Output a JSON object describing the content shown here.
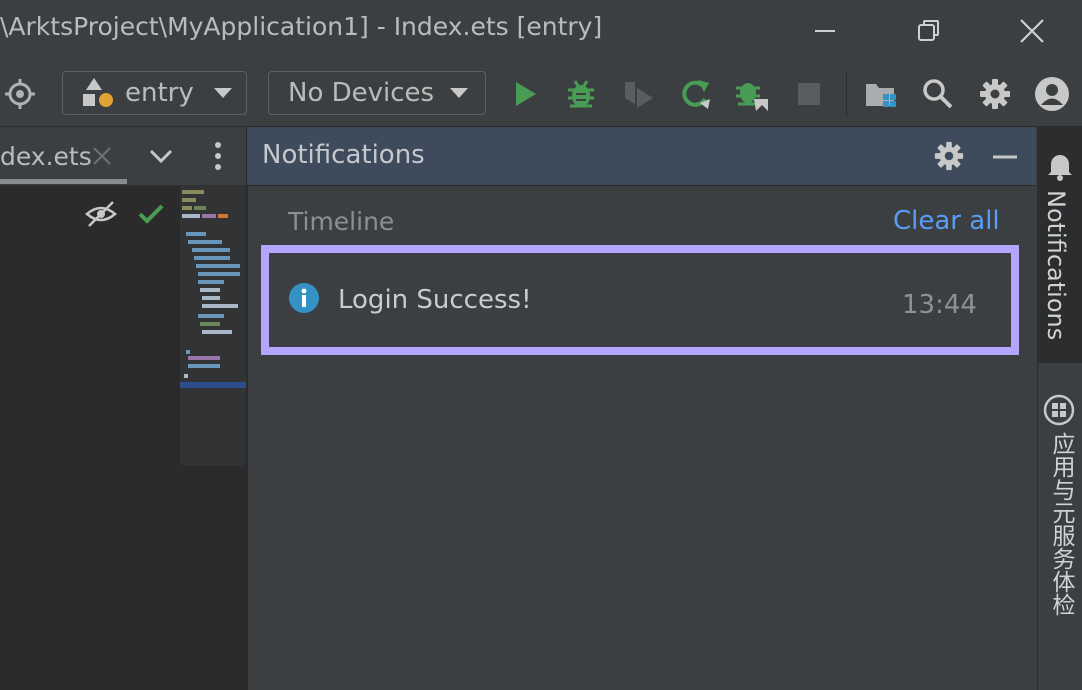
{
  "window": {
    "title": "\\ArktsProject\\MyApplication1] - Index.ets [entry]"
  },
  "toolbar": {
    "module_combo": {
      "label": "entry"
    },
    "device_combo": {
      "label": "No Devices"
    }
  },
  "editor": {
    "tab_label": "dex.ets"
  },
  "notifications": {
    "header_title": "Notifications",
    "section_label": "Timeline",
    "clear_all_label": "Clear all",
    "items": [
      {
        "message": "Login Success!",
        "time": "13:44",
        "type": "info"
      }
    ]
  },
  "right_strip": {
    "notifications_label": "Notifications",
    "app_service_check_label": "应用与元服务体检"
  },
  "colors": {
    "accent_link": "#589df6",
    "run_green": "#499c54",
    "highlight_border": "#b4a6ff",
    "info_blue": "#3592c4"
  }
}
